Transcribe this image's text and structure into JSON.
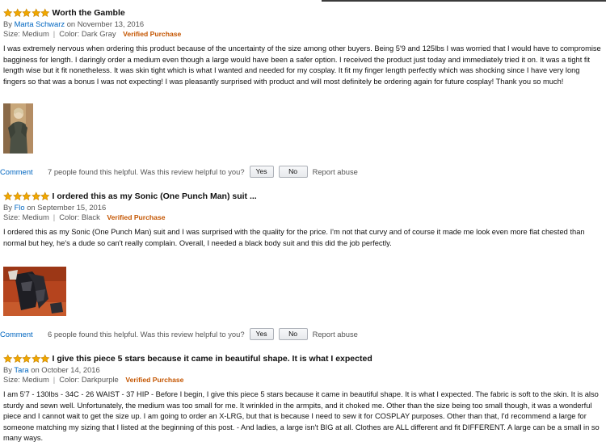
{
  "reviews": [
    {
      "rating": 5,
      "title": "Worth the Gamble",
      "by": "By",
      "author": "Marta Schwarz",
      "date": "on November 13, 2016",
      "size": "Size: Medium",
      "color": "Color: Dark Gray",
      "verified": "Verified Purchase",
      "body": "I was extremely nervous when ordering this product because of the uncertainty of the size among other buyers. Being 5'9 and 125lbs I was worried that I would have to compromise bagginess for length. I daringly order a medium even though a large would have been a safer option. I received the product just today and immediately tried it on. It was a tight fit length wise but it fit nonetheless. It was skin tight which is what I wanted and needed for my cosplay. It fit my finger length perfectly which was shocking since I have very long fingers so that was a bonus I was not expecting! I was pleasantly surprised with product and will most definitely be ordering again for future cosplay! Thank you so much!",
      "comment": "Comment",
      "helpful": "7 people found this helpful. Was this review helpful to you?",
      "yes": "Yes",
      "no": "No",
      "abuse": "Report abuse"
    },
    {
      "rating": 5,
      "title": "I ordered this as my Sonic (One Punch Man) suit ...",
      "by": "By",
      "author": "Flo",
      "date": "on September 15, 2016",
      "size": "Size: Medium",
      "color": "Color: Black",
      "verified": "Verified Purchase",
      "body": "I ordered this as my Sonic (One Punch Man) suit and I was surprised with the quality for the price. I'm not that curvy and of course it made me look even more flat chested than normal but hey, he's a dude so can't really complain. Overall, I needed a black body suit and this did the job perfectly.",
      "comment": "Comment",
      "helpful": "6 people found this helpful. Was this review helpful to you?",
      "yes": "Yes",
      "no": "No",
      "abuse": "Report abuse"
    },
    {
      "rating": 5,
      "title": "I give this piece 5 stars because it came in beautiful shape. It is what I expected",
      "by": "By",
      "author": "Tara",
      "date": "on October 14, 2016",
      "size": "Size: Medium",
      "color": "Color: Darkpurple",
      "verified": "Verified Purchase",
      "body": "I am 5'7 - 130lbs - 34C - 26 WAIST - 37 HIP - Before I begin, I give this piece 5 stars because it came in beautiful shape. It is what I expected. The fabric is soft to the skin. It is also sturdy and sewn well. Unfortunately, the medium was too small for me. It wrinkled in the armpits, and it choked me. Other than the size being too small though, it was a wonderful piece and I cannot wait to get the size up. I am going to order an X-LRG, but that is because I need to sew it for COSPLAY purposes. Other than that, I'd recommend a large for someone matching my sizing that I listed at the beginning of this post. - And ladies, a large isn't BIG at all. Clothes are ALL different and fit DIFFERENT. A large can be a small in so many ways."
    }
  ],
  "colors": {
    "star": "#f0a800",
    "link": "#0066c0",
    "verified": "#c45500",
    "meta": "#555555"
  },
  "icons": {
    "star": "star-icon"
  }
}
